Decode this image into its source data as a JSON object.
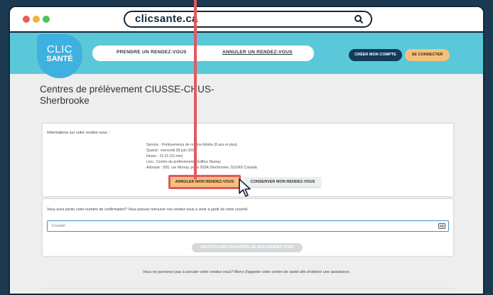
{
  "browser": {
    "url": "clicsante.ca"
  },
  "header": {
    "logo_line1": "CLIC",
    "logo_line2": "SANTÉ",
    "nav": {
      "prendre": "PRENDRE UN RENDEZ-VOUS",
      "annuler": "ANNULER UN RENDEZ-VOUS"
    },
    "creer_compte": "CRÉER MON COMPTE",
    "se_connecter": "SE CONNECTER"
  },
  "page": {
    "title": "Centres de prélèvement CIUSSE-CHUS-Sherbrooke"
  },
  "appointment": {
    "heading": "Informations sur votre rendez-vous :",
    "lines": [
      "Service : Prélèvements de routine Adulte (8 ans et plus)",
      "Quand : mercredi 28 juin 202",
      "Heure : 11:15 (15 min)",
      "Lieu : Centre de prélèvement - Édifice Murray",
      "Adresse : 500, rue Murray, porte 503A Sherbrooke J1G2K6 Canada"
    ],
    "annuler_button": "ANNULER MON RENDEZ-VOUS",
    "conserver_button": "CONSERVER MON RENDEZ-VOUS"
  },
  "reminder": {
    "text": "Vous avez perdu votre numéro de confirmation? Vous pouvez retrouver vos rendez-vous à venir à partir de votre courriel.",
    "email_placeholder": "Courriel",
    "email_icon": "id-card-icon",
    "button": "ENVOYEZ-MOI UN RAPPEL DE MES RENDEZ-VOUS"
  },
  "footer": {
    "text": "Vous ne parvenez pas à annuler votre rendez-vous? Merci d'appeler votre centre de santé afin d'obtenir une assistance."
  },
  "colors": {
    "header": "#5ac8d8",
    "logo": "#3fb1e1",
    "accent_orange": "#f6c07c",
    "navy": "#123a5c",
    "highlight_red": "#e05a5e"
  }
}
